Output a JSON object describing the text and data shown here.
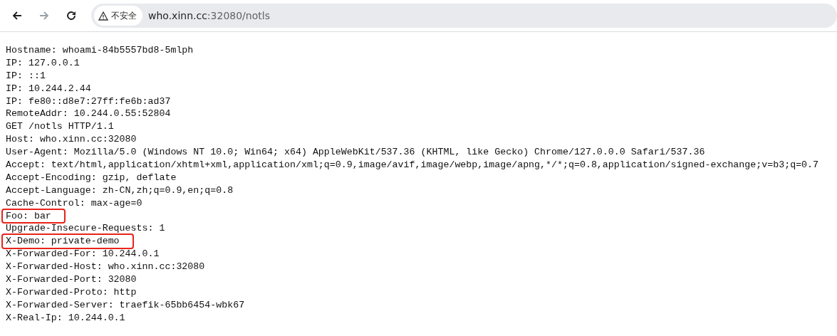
{
  "toolbar": {
    "back": {
      "disabled": false
    },
    "forward": {
      "disabled": true
    },
    "security_chip": "不安全",
    "address": {
      "host": "who.xinn.cc",
      "path": ":32080/notls"
    }
  },
  "lines": [
    {
      "text": "Hostname: whoami-84b5557bd8-5mlph",
      "highlighted": false
    },
    {
      "text": "IP: 127.0.0.1",
      "highlighted": false
    },
    {
      "text": "IP: ::1",
      "highlighted": false
    },
    {
      "text": "IP: 10.244.2.44",
      "highlighted": false
    },
    {
      "text": "IP: fe80::d8e7:27ff:fe6b:ad37",
      "highlighted": false
    },
    {
      "text": "RemoteAddr: 10.244.0.55:52804",
      "highlighted": false
    },
    {
      "text": "GET /notls HTTP/1.1",
      "highlighted": false
    },
    {
      "text": "Host: who.xinn.cc:32080",
      "highlighted": false
    },
    {
      "text": "User-Agent: Mozilla/5.0 (Windows NT 10.0; Win64; x64) AppleWebKit/537.36 (KHTML, like Gecko) Chrome/127.0.0.0 Safari/537.36",
      "highlighted": false
    },
    {
      "text": "Accept: text/html,application/xhtml+xml,application/xml;q=0.9,image/avif,image/webp,image/apng,*/*;q=0.8,application/signed-exchange;v=b3;q=0.7",
      "highlighted": false
    },
    {
      "text": "Accept-Encoding: gzip, deflate",
      "highlighted": false
    },
    {
      "text": "Accept-Language: zh-CN,zh;q=0.9,en;q=0.8",
      "highlighted": false
    },
    {
      "text": "Cache-Control: max-age=0",
      "highlighted": false
    },
    {
      "text": "Foo: bar",
      "highlighted": true
    },
    {
      "text": "Upgrade-Insecure-Requests: 1",
      "highlighted": false
    },
    {
      "text": "X-Demo: private-demo",
      "highlighted": true
    },
    {
      "text": "X-Forwarded-For: 10.244.0.1",
      "highlighted": false
    },
    {
      "text": "X-Forwarded-Host: who.xinn.cc:32080",
      "highlighted": false
    },
    {
      "text": "X-Forwarded-Port: 32080",
      "highlighted": false
    },
    {
      "text": "X-Forwarded-Proto: http",
      "highlighted": false
    },
    {
      "text": "X-Forwarded-Server: traefik-65bb6454-wbk67",
      "highlighted": false
    },
    {
      "text": "X-Real-Ip: 10.244.0.1",
      "highlighted": false
    }
  ]
}
